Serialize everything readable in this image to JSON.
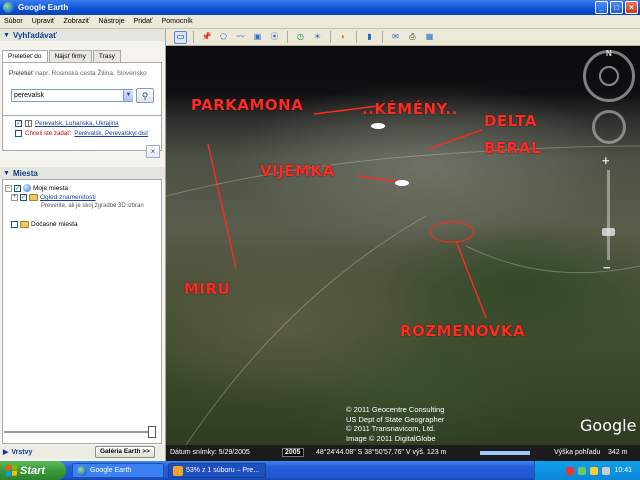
{
  "window": {
    "title": "Google Earth",
    "buttons": [
      "_",
      "□",
      "×"
    ]
  },
  "menu": [
    "Súbor",
    "Upraviť",
    "Zobraziť",
    "Nástroje",
    "Pridať",
    "Pomocník"
  ],
  "search": {
    "header": "Vyhľadávať",
    "tabs": [
      "Preletieť do",
      "Nájsť firmy",
      "Trasy"
    ],
    "hint_label": "Preletieť",
    "hint_example": "napr. Rosinská cesta Žilina, Slovensko",
    "input_value": "perevalsk",
    "search_icon": "magnifier-icon",
    "results": [
      {
        "text": "Perevalsk, Luhanska, Ukrajina",
        "type": "result"
      },
      {
        "prefix": "Chceli ste zadať:",
        "text": "Perevalśk, Perevalśkyi dist",
        "type": "suggestion"
      }
    ],
    "close_label": "×"
  },
  "places": {
    "header": "Miesta",
    "items": [
      {
        "label": "Moje miesta",
        "level": 0
      },
      {
        "label": "Ogled znamenitosti",
        "sublabel": "Preverite, ali je skoj žgradbe 3D izbran",
        "level": 1
      },
      {
        "label": "Dočasné miesta",
        "level": 0
      }
    ]
  },
  "layers": {
    "header": "Vrstvy",
    "gallery_button": "Galéria Earth  >>"
  },
  "toolbar": {
    "icons": [
      "sidebar-icon",
      "placemark-icon",
      "polygon-icon",
      "path-icon",
      "overlay-icon",
      "tour-icon",
      "history-icon",
      "sun-icon",
      "planet-icon",
      "ruler-icon",
      "email-icon",
      "print-icon",
      "maps-icon"
    ]
  },
  "map": {
    "labels": [
      "PARKAMONA",
      "..KÉMÉNY..",
      "DELTA",
      "BERAL",
      "VIJEMKA",
      "MIRU",
      "ROZMENOVKA"
    ],
    "copyright": [
      "© 2011 Geocentre Consulting",
      "US Dept of State Geographer",
      "© 2011 Transnavicom, Ltd.",
      "Image © 2011 DigitalGlobe"
    ],
    "logo": "Google",
    "nav_north": "N"
  },
  "status": {
    "date_label": "Dátum snímky: 5/29/2005",
    "year": "2005",
    "coords": "48°24'44.08\" S   38°50'57.76\" V   výš.   123 m",
    "view": "Výška pohľadu",
    "altitude": "342 m"
  },
  "taskbar": {
    "start": "Start",
    "tasks": [
      "Google Earth",
      "53% z 1 súboru – Pre..."
    ],
    "clock": "10:41"
  },
  "colors": {
    "label_red": "#ff2a22",
    "title_blue": "#0a4fd6",
    "start_green": "#3a9a3a"
  }
}
